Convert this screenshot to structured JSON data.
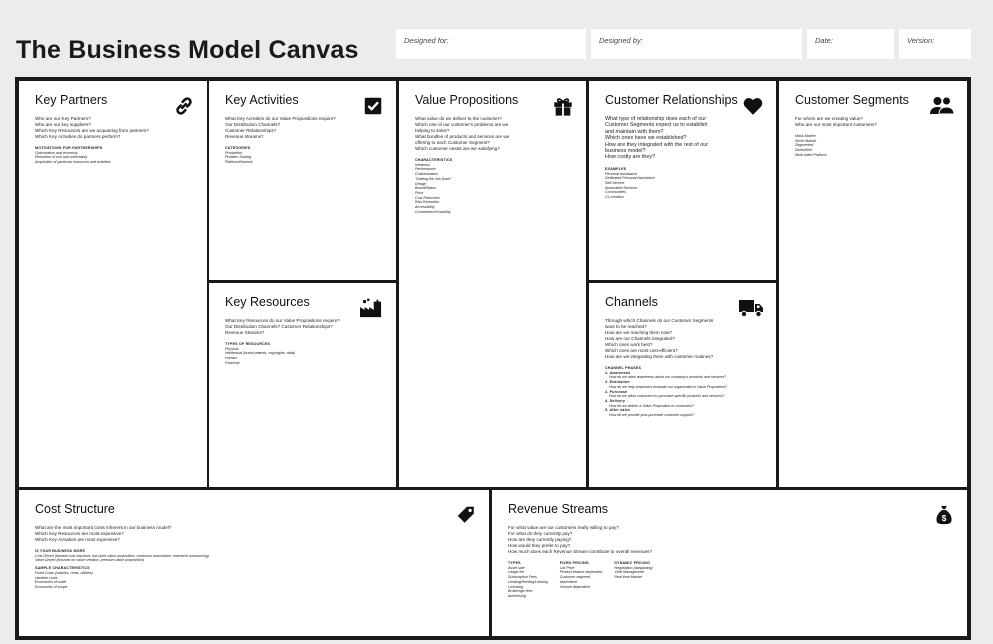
{
  "title": "The Business Model Canvas",
  "meta": {
    "designed_for": "Designed for:",
    "designed_by": "Designed by:",
    "date": "Date:",
    "version": "Version:"
  },
  "key_partners": {
    "title": "Key Partners",
    "icon": "link-icon",
    "questions": [
      "Who are our Key Partners?",
      "Who are our key suppliers?",
      "Which Key Resources are we acquairing from partners?",
      "Which Key Activities do partners perform?"
    ],
    "section_title": "MOTIVATIONS FOR PARTNERSHIPS",
    "items": [
      "Optimization and economy",
      "Reduction of risk and uncertainty",
      "Acquisition of particular resources and activities"
    ]
  },
  "key_activities": {
    "title": "Key Activities",
    "icon": "checkbox-icon",
    "questions": [
      "What Key Activities do our Value Propositions require?",
      "Our Distribution Channels?",
      "Customer Relationships?",
      "Revenue streams?"
    ],
    "section_title": "CATEGORIES",
    "items": [
      "Production",
      "Problem Solving",
      "Platform/Network"
    ]
  },
  "key_resources": {
    "title": "Key Resources",
    "icon": "factory-icon",
    "questions": [
      "What Key Resources do our Value Propositions require?",
      "Our Distribution Channels? Customer Relationships?",
      "Revenue Streams?"
    ],
    "section_title": "TYPES OF RESOURCES",
    "items": [
      "Physical",
      "Intellectual (brand patents, copyrights, data)",
      "Human",
      "Financial"
    ]
  },
  "value_propositions": {
    "title": "Value Propositions",
    "icon": "gift-icon",
    "questions": [
      "What value do we deliver to the customer?",
      "Which one of our customer's problems are we",
      "helping to solve?",
      "What bundles of products and services are we",
      "offering to each Customer Segment?",
      "Which customer needs are we satisfying?"
    ],
    "section_title": "CHARACTERISTICS",
    "items": [
      "Newness",
      "Performance",
      "Customization",
      "\"Getting the Job Done\"",
      "Design",
      "Brand/Status",
      "Price",
      "Cost Reduction",
      "Risk Reduction",
      "Accessibility",
      "Convenience/Usability"
    ]
  },
  "customer_relationships": {
    "title": "Customer Relationships",
    "icon": "heart-icon",
    "questions": [
      "What type of relationship does each of our",
      "Customer Segments expect us to establish",
      "and maintain with them?",
      "Which ones have we established?",
      "How are they integrated with the rest of our",
      "business model?",
      "How costly are they?"
    ],
    "section_title": "EXAMPLES",
    "items": [
      "Personal assistance",
      "Dedicated Personal Assistance",
      "Self-Service",
      "Automated Services",
      "Communities",
      "Co-creation"
    ]
  },
  "channels": {
    "title": "Channels",
    "icon": "truck-icon",
    "questions": [
      "Through which Channels do our Customer Segments",
      "want to be reached?",
      "How are we reaching them now?",
      "How are our Channels integrated?",
      "Which ones work best?",
      "Which ones are most cost-efficient?",
      "How are we integrating them with customer routines?"
    ],
    "section_title": "CHANNEL PHASES",
    "phases": [
      {
        "label": "1. Awareness",
        "detail": "How do we raise awareness about our company's products and services?"
      },
      {
        "label": "2. Evaluation",
        "detail": "How do we help customers evaluate our organization's Value Proposition?"
      },
      {
        "label": "3. Purchase",
        "detail": "How do we allow customers to purchase specific products and services?"
      },
      {
        "label": "4. Delivery",
        "detail": "How do we deliver a Value Proposition to customers?"
      },
      {
        "label": "5. After sales",
        "detail": "How do we provide post-purchase customer support?"
      }
    ]
  },
  "customer_segments": {
    "title": "Customer Segments",
    "icon": "people-icon",
    "questions": [
      "For whom are we creating value?",
      "Who are our most important customers?"
    ],
    "items": [
      "Mass Market",
      "Niche Market",
      "Segmented",
      "Diversified",
      "Multi-sided Platform"
    ]
  },
  "cost_structure": {
    "title": "Cost Structure",
    "icon": "tag-icon",
    "questions": [
      "What are the most important costs inherent in our business model?",
      "Which Key Resources are most expensive?",
      "Which Key Activities are most expensive?"
    ],
    "section1_title": "IS YOUR BUSINESS MORE",
    "section1_items": [
      "Cost Driven (leanest cost structure, low price value proposition, maximum automation, extensive outsourcing)",
      "Value Driven (focused on value creation, premium value proposition)"
    ],
    "section2_title": "SAMPLE CHARACTERISTICS",
    "section2_items": [
      "Fixed Costs (salaries, rents, utilities)",
      "Variable costs",
      "Economies of scale",
      "Economies of scope"
    ]
  },
  "revenue_streams": {
    "title": "Revenue Streams",
    "icon": "money-bag-icon",
    "questions": [
      "For what value are our customers really willing to pay?",
      "For what do they currently pay?",
      "How are they currently paying?",
      "How would they prefer to pay?",
      "How much does each Revenue Stream contribute to overall revenues?"
    ],
    "columns": [
      {
        "title": "TYPES",
        "items": [
          "Asset sale",
          "Usage fee",
          "Subscription Fees",
          "Lending/Renting/Leasing",
          "Licensing",
          "Brokerage fees",
          "Advertising"
        ]
      },
      {
        "title": "FIXED PRICING",
        "items": [
          "List Price",
          "Product feature dependent",
          "Customer segment",
          "dependent",
          "Volume dependent"
        ]
      },
      {
        "title": "DYNAMIC PRICING",
        "items": [
          "Negotiation (bargaining)",
          "Yield Management",
          "Real-time-Market"
        ]
      }
    ]
  }
}
